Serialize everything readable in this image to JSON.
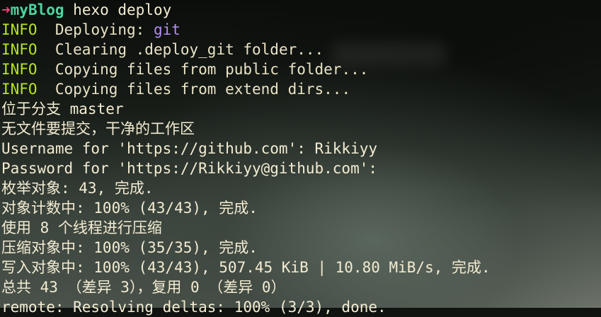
{
  "prompt": {
    "arrow": "➜",
    "dir": "myBlog",
    "command": "hexo deploy"
  },
  "lines": [
    {
      "tag": "INFO",
      "sep": "  ",
      "msg": "Deploying: ",
      "highlight": "git"
    },
    {
      "tag": "INFO",
      "sep": "  ",
      "msg": "Clearing .deploy_git folder..."
    },
    {
      "tag": "INFO",
      "sep": "  ",
      "msg": "Copying files from public folder..."
    },
    {
      "tag": "INFO",
      "sep": "  ",
      "msg": "Copying files from extend dirs..."
    },
    {
      "text": "位于分支 master"
    },
    {
      "text": "无文件要提交，干净的工作区"
    },
    {
      "text": "Username for 'https://github.com': Rikkiyy"
    },
    {
      "text": "Password for 'https://Rikkiyy@github.com':"
    },
    {
      "text": "枚举对象: 43, 完成."
    },
    {
      "text": "对象计数中: 100% (43/43), 完成."
    },
    {
      "text": "使用 8 个线程进行压缩"
    },
    {
      "text": "压缩对象中: 100% (35/35), 完成."
    },
    {
      "text": "写入对象中: 100% (43/43), 507.45 KiB | 10.80 MiB/s, 完成."
    },
    {
      "text": "总共 43 （差异 3），复用 0 （差异 0）"
    },
    {
      "text": "remote: Resolving deltas: 100% (3/3), done."
    }
  ],
  "colors": {
    "prompt_arrow": "#ff3d7f",
    "prompt_dir": "#4fd39e",
    "info_tag": "#b6e51f",
    "highlight": "#b48cf7",
    "text": "#f3ecd2"
  }
}
